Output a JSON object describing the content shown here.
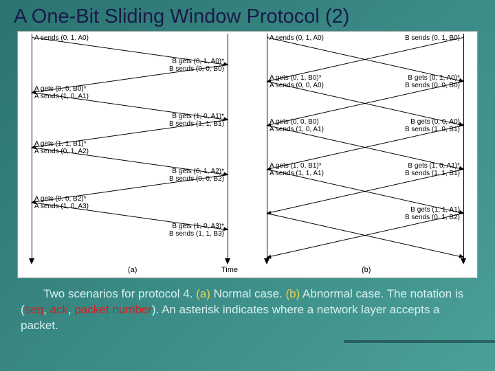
{
  "title": "A One-Bit Sliding Window Protocol (2)",
  "caption_parts": {
    "p1": "Two scenarios for protocol 4. ",
    "a": "(a)",
    "p2": " Normal case. ",
    "b": "(b)",
    "p3": " Abnormal case.  The notation is (",
    "seq": "seq",
    "c1": ", ",
    "ack": "ack",
    "c2": ", ",
    "pkt": "packet number",
    "p4": ").  An asterisk indicates where a network layer accepts a packet."
  },
  "panel_a": {
    "left": [
      "A sends (0, 1, A0)",
      "A gets (0, 0, B0)*\nA sends (1, 0, A1)",
      "A gets (1, 1, B1)*\nA sends (0, 1, A2)",
      "A gets (0, 0, B2)*\nA sends (1, 0, A3)"
    ],
    "right": [
      "B gets (0, 1, A0)*\nB sends (0, 0, B0)",
      "B gets (1, 0, A1)*\nB sends (1, 1, B1)",
      "B gets (0, 1, A2)*\nB sends (0, 0, B2)",
      "B gets (1, 0, A3)*\nB sends (1, 1, B3)"
    ]
  },
  "panel_b": {
    "left": [
      "A sends (0, 1, A0)",
      "A gets (0, 1, B0)*\nA sends (0, 0, A0)",
      "A gets (0, 0, B0)\nA sends (1, 0, A1)",
      "A gets (1, 0, B1)*\nA sends (1, 1, A1)"
    ],
    "right": [
      "B sends (0, 1, B0)",
      "B gets (0, 1, A0)*\nB sends (0, 0, B0)",
      "B gets (0, 0, A0)\nB sends (1, 0, B1)",
      "B gets (1, 0, A1)*\nB sends (1, 1, B1)",
      "B gets (1, 1, A1)\nB sends (0, 1, B2)"
    ]
  },
  "axis": {
    "a": "(a)",
    "b": "(b)",
    "time": "Time"
  }
}
